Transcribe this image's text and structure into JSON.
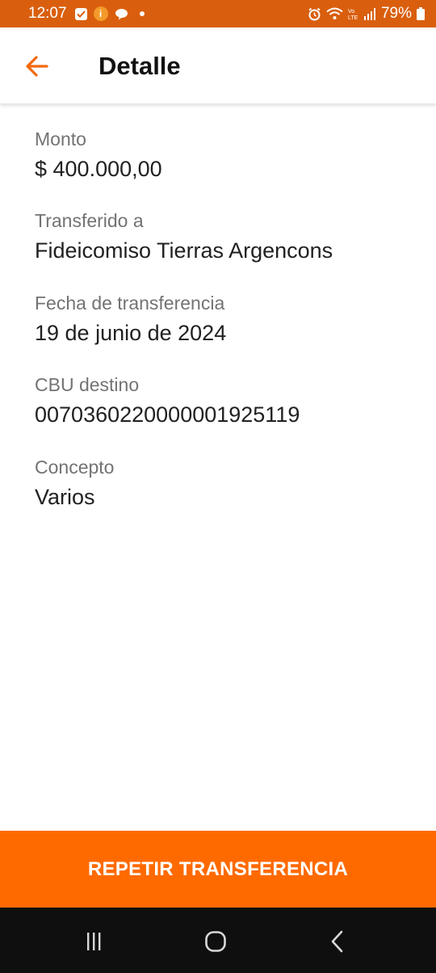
{
  "status_bar": {
    "time": "12:07",
    "battery_percent": "79%",
    "icons": [
      "check-notification-icon",
      "info-notification-icon",
      "chat-notification-icon",
      "dot-icon",
      "alarm-icon",
      "wifi-icon",
      "volte-icon",
      "signal-icon",
      "battery-icon"
    ]
  },
  "header": {
    "title": "Detalle",
    "back_icon": "arrow-left-icon"
  },
  "details": [
    {
      "label": "Monto",
      "value": "$ 400.000,00"
    },
    {
      "label": "Transferido a",
      "value": "Fideicomiso Tierras Argencons"
    },
    {
      "label": "Fecha de transferencia",
      "value": "19 de junio de 2024"
    },
    {
      "label": "CBU destino",
      "value": "0070360220000001925119"
    },
    {
      "label": "Concepto",
      "value": "Varios"
    }
  ],
  "action": {
    "repeat_label": "REPETIR TRANSFERENCIA"
  },
  "nav_bar": {
    "icons": [
      "recent-apps-icon",
      "home-icon",
      "back-nav-icon"
    ]
  },
  "colors": {
    "status_bar": "#d95f0e",
    "accent": "#ff6a00",
    "back_arrow": "#f26a0c"
  }
}
